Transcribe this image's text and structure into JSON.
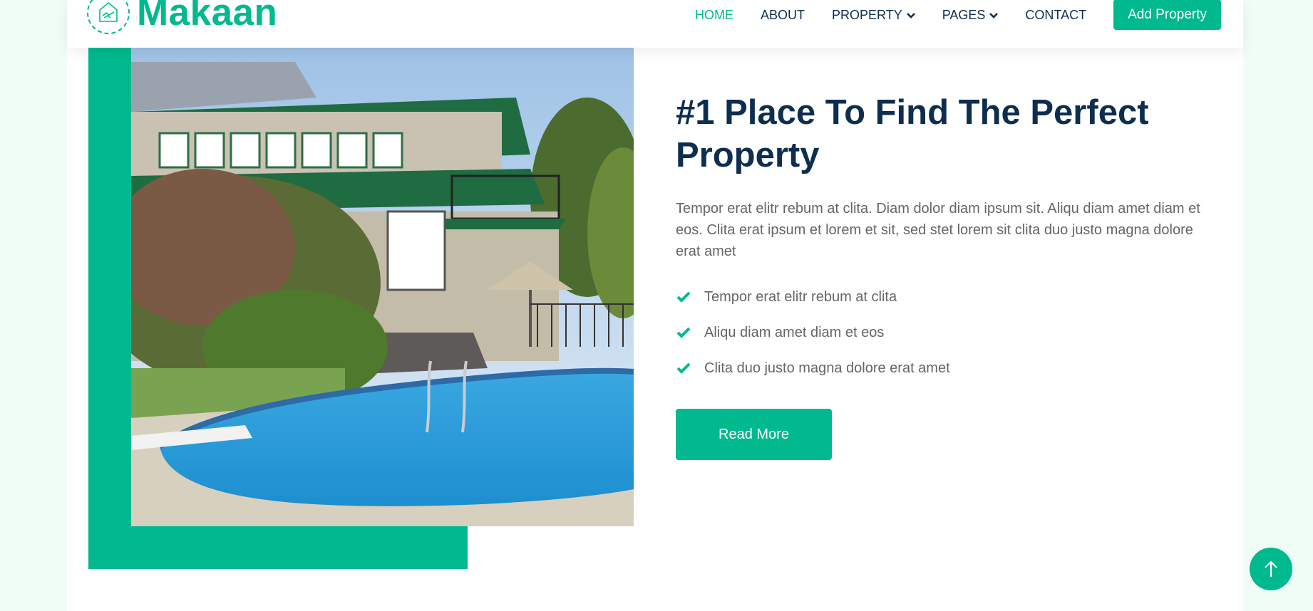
{
  "brand": {
    "name": "Makaan",
    "logo_icon": "handshake-house-icon"
  },
  "nav": {
    "items": [
      {
        "label": "HOME",
        "active": true,
        "dropdown": false
      },
      {
        "label": "ABOUT",
        "active": false,
        "dropdown": false
      },
      {
        "label": "PROPERTY",
        "active": false,
        "dropdown": true
      },
      {
        "label": "PAGES",
        "active": false,
        "dropdown": true
      },
      {
        "label": "CONTACT",
        "active": false,
        "dropdown": false
      }
    ],
    "cta_label": "Add Property"
  },
  "about": {
    "title": "#1 Place To Find The Perfect Property",
    "description": "Tempor erat elitr rebum at clita. Diam dolor diam ipsum sit. Aliqu diam amet diam et eos. Clita erat ipsum et lorem et sit, sed stet lorem sit clita duo justo magna dolore erat amet",
    "features": [
      "Tempor erat elitr rebum at clita",
      "Aliqu diam amet diam et eos",
      "Clita duo justo magna dolore erat amet"
    ],
    "button_label": "Read More",
    "image_icon": "house-with-pool-photo"
  },
  "back_to_top_icon": "arrow-up-icon",
  "colors": {
    "primary": "#00b98e",
    "dark": "#0e2e50",
    "text": "#666565",
    "page_bg": "#effdf5"
  }
}
